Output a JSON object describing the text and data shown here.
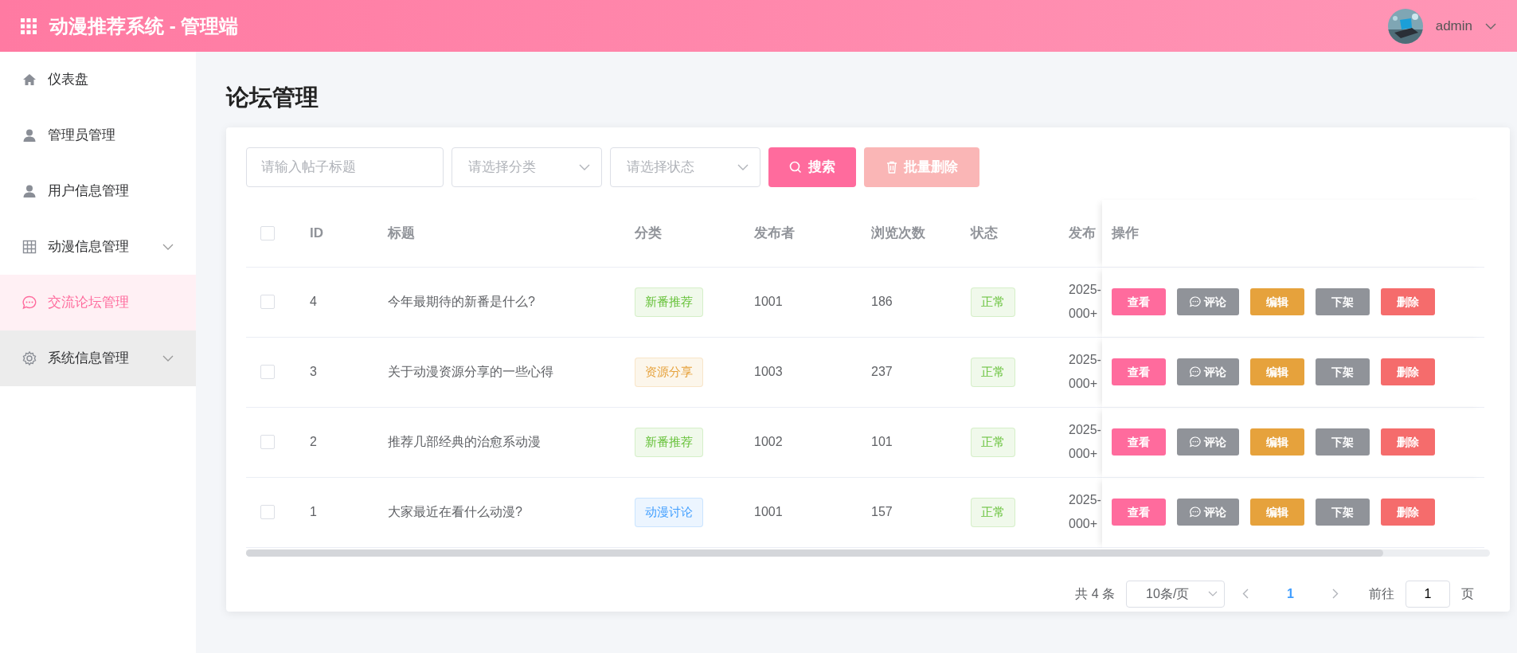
{
  "header": {
    "title": "动漫推荐系统 - 管理端",
    "user": "admin"
  },
  "sidebar": {
    "items": [
      {
        "label": "仪表盘",
        "kind": "home",
        "selected": false,
        "hovered": false,
        "expandable": false
      },
      {
        "label": "管理员管理",
        "kind": "person",
        "selected": false,
        "hovered": false,
        "expandable": false
      },
      {
        "label": "用户信息管理",
        "kind": "person",
        "selected": false,
        "hovered": false,
        "expandable": false
      },
      {
        "label": "动漫信息管理",
        "kind": "grid",
        "selected": false,
        "hovered": false,
        "expandable": true
      },
      {
        "label": "交流论坛管理",
        "kind": "chat",
        "selected": true,
        "hovered": false,
        "expandable": false
      },
      {
        "label": "系统信息管理",
        "kind": "gear",
        "selected": false,
        "hovered": true,
        "expandable": true
      }
    ]
  },
  "page_title": "论坛管理",
  "filters": {
    "title_placeholder": "请输入帖子标题",
    "category_placeholder": "请选择分类",
    "status_placeholder": "请选择状态",
    "search_button": "搜索",
    "batch_delete_button": "批量删除",
    "batch_delete_disabled": true
  },
  "table": {
    "header_checked": false,
    "columns": [
      "ID",
      "标题",
      "分类",
      "发布者",
      "浏览次数",
      "状态",
      "发布",
      "操作"
    ],
    "rows": [
      {
        "checked": false,
        "id": "4",
        "title": "今年最期待的新番是什么?",
        "category": {
          "label": "新番推荐",
          "color": "#67c23a"
        },
        "author": "1001",
        "views": "186",
        "status": {
          "label": "正常",
          "color": "#67c23a"
        },
        "published": "2025-\n000+",
        "actions": [
          {
            "label": "查看",
            "kind": "view"
          },
          {
            "label": "评论",
            "kind": "comment"
          },
          {
            "label": "编辑",
            "kind": "edit"
          },
          {
            "label": "下架",
            "kind": "offline"
          },
          {
            "label": "删除",
            "kind": "delete"
          }
        ]
      },
      {
        "checked": false,
        "id": "3",
        "title": "关于动漫资源分享的一些心得",
        "category": {
          "label": "资源分享",
          "color": "#e6a23c"
        },
        "author": "1003",
        "views": "237",
        "status": {
          "label": "正常",
          "color": "#67c23a"
        },
        "published": "2025-\n000+",
        "actions": [
          {
            "label": "查看",
            "kind": "view"
          },
          {
            "label": "评论",
            "kind": "comment"
          },
          {
            "label": "编辑",
            "kind": "edit"
          },
          {
            "label": "下架",
            "kind": "offline"
          },
          {
            "label": "删除",
            "kind": "delete"
          }
        ]
      },
      {
        "checked": false,
        "id": "2",
        "title": "推荐几部经典的治愈系动漫",
        "category": {
          "label": "新番推荐",
          "color": "#67c23a"
        },
        "author": "1002",
        "views": "101",
        "status": {
          "label": "正常",
          "color": "#67c23a"
        },
        "published": "2025-\n000+",
        "actions": [
          {
            "label": "查看",
            "kind": "view"
          },
          {
            "label": "评论",
            "kind": "comment"
          },
          {
            "label": "编辑",
            "kind": "edit"
          },
          {
            "label": "下架",
            "kind": "offline"
          },
          {
            "label": "删除",
            "kind": "delete"
          }
        ]
      },
      {
        "checked": false,
        "id": "1",
        "title": "大家最近在看什么动漫?",
        "category": {
          "label": "动漫讨论",
          "color": "#409eff"
        },
        "author": "1001",
        "views": "157",
        "status": {
          "label": "正常",
          "color": "#67c23a"
        },
        "published": "2025-\n000+",
        "actions": [
          {
            "label": "查看",
            "kind": "view"
          },
          {
            "label": "评论",
            "kind": "comment"
          },
          {
            "label": "编辑",
            "kind": "edit"
          },
          {
            "label": "下架",
            "kind": "offline"
          },
          {
            "label": "删除",
            "kind": "delete"
          }
        ]
      }
    ]
  },
  "pagination": {
    "total": "共 4 条",
    "page_size": "10条/页",
    "pages": [
      {
        "label": "1",
        "selected": true
      }
    ],
    "goto_label": "前往",
    "goto_value": "1",
    "page_suffix": "页"
  }
}
